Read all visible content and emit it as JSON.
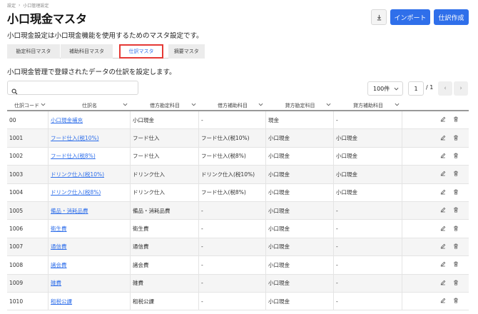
{
  "breadcrumb": [
    "設定",
    "小口管理設定"
  ],
  "page_title": "小口現金マスタ",
  "buttons": {
    "import": "インポート",
    "create": "仕訳作成"
  },
  "description": "小口現金設定は小口現金機能を使用するためのマスタ設定です。",
  "tabs": [
    {
      "label": "勘定科目マスタ",
      "active": false
    },
    {
      "label": "補助科目マスタ",
      "active": false
    },
    {
      "label": "仕訳マスタ",
      "active": true
    },
    {
      "label": "摘要マスタ",
      "active": false
    }
  ],
  "subdescription": "小口現金管理で登録されたデータの仕訳を設定します。",
  "search": {
    "placeholder": ""
  },
  "pagination": {
    "per_page": "100件",
    "page": "1",
    "total": "/ 1",
    "prev": "‹",
    "next": "›"
  },
  "table": {
    "columns": [
      "仕訳コード",
      "仕訳名",
      "借方勘定科目",
      "借方補助科目",
      "貸方勘定科目",
      "貸方補助科目"
    ],
    "rows": [
      {
        "code": "00",
        "name": "小口現金補充",
        "debit_account": "小口現金",
        "debit_sub": "-",
        "credit_account": "現金",
        "credit_sub": "-"
      },
      {
        "code": "1001",
        "name": "フード仕入(税10%)",
        "debit_account": "フード仕入",
        "debit_sub": "フード仕入(税10%)",
        "credit_account": "小口現金",
        "credit_sub": "小口現金"
      },
      {
        "code": "1002",
        "name": "フード仕入(税8%)",
        "debit_account": "フード仕入",
        "debit_sub": "フード仕入(税8%)",
        "credit_account": "小口現金",
        "credit_sub": "小口現金"
      },
      {
        "code": "1003",
        "name": "ドリンク仕入(税10%)",
        "debit_account": "ドリンク仕入",
        "debit_sub": "ドリンク仕入(税10%)",
        "credit_account": "小口現金",
        "credit_sub": "小口現金"
      },
      {
        "code": "1004",
        "name": "ドリンク仕入(税8%)",
        "debit_account": "ドリンク仕入",
        "debit_sub": "フード仕入(税8%)",
        "credit_account": "小口現金",
        "credit_sub": "小口現金"
      },
      {
        "code": "1005",
        "name": "備品・消耗品費",
        "debit_account": "備品・消耗品費",
        "debit_sub": "-",
        "credit_account": "小口現金",
        "credit_sub": "-"
      },
      {
        "code": "1006",
        "name": "衛生費",
        "debit_account": "衛生費",
        "debit_sub": "-",
        "credit_account": "小口現金",
        "credit_sub": "-"
      },
      {
        "code": "1007",
        "name": "通信費",
        "debit_account": "通信費",
        "debit_sub": "-",
        "credit_account": "小口現金",
        "credit_sub": "-"
      },
      {
        "code": "1008",
        "name": "諸会費",
        "debit_account": "諸会費",
        "debit_sub": "-",
        "credit_account": "小口現金",
        "credit_sub": "-"
      },
      {
        "code": "1009",
        "name": "雑費",
        "debit_account": "雑費",
        "debit_sub": "-",
        "credit_account": "小口現金",
        "credit_sub": "-"
      },
      {
        "code": "1010",
        "name": "租税公課",
        "debit_account": "租税公課",
        "debit_sub": "-",
        "credit_account": "小口現金",
        "credit_sub": "-"
      }
    ]
  },
  "icons": {
    "download": "download-icon",
    "search": "search-icon",
    "edit": "pencil-icon",
    "delete": "trash-icon"
  },
  "colors": {
    "primary": "#2f6fea",
    "active_tab_border": "#e53935"
  }
}
